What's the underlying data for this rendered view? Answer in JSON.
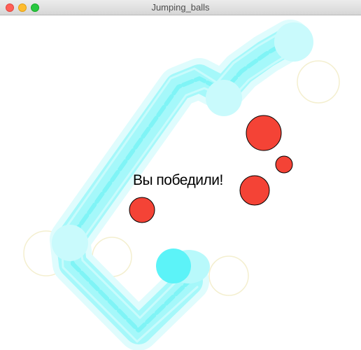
{
  "window": {
    "title": "Jumping_balls"
  },
  "game": {
    "message": "Вы победили!",
    "colors": {
      "trail": "#7ff4f6",
      "player": "#5cf3f8",
      "enemy": "#f44336",
      "faint_ring": "#f4efcf",
      "background": "#ffffff"
    }
  }
}
